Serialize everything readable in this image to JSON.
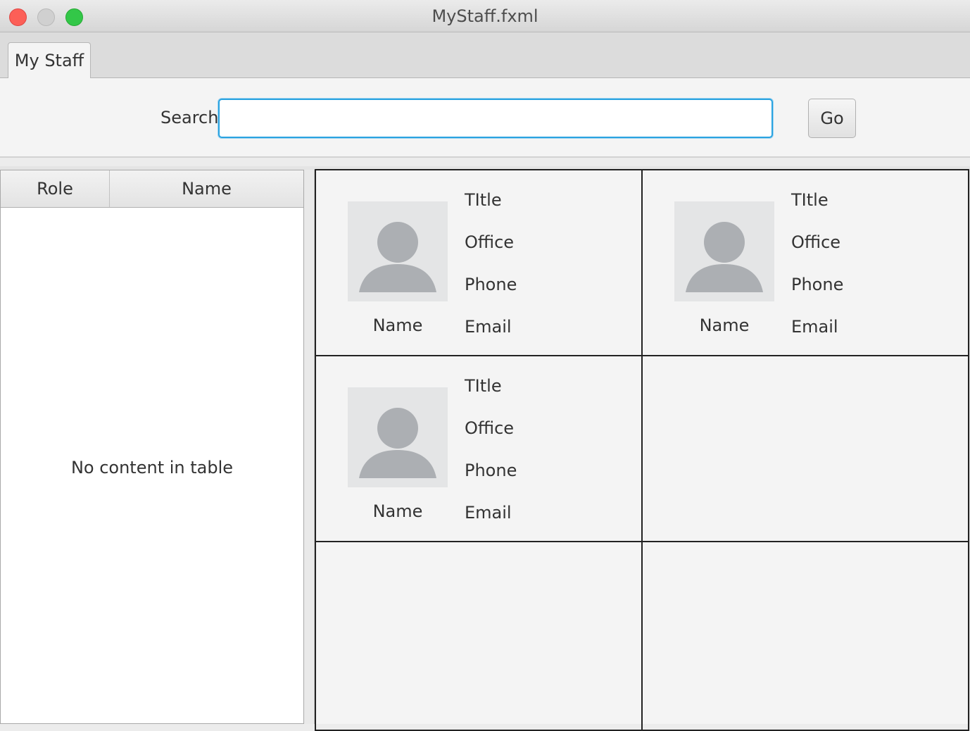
{
  "window": {
    "title": "MyStaff.fxml"
  },
  "tabs": [
    {
      "label": "My Staff"
    }
  ],
  "search": {
    "label": "Search",
    "value": "",
    "placeholder": "",
    "go_label": "Go"
  },
  "table": {
    "columns": [
      {
        "label": "Role"
      },
      {
        "label": "Name"
      }
    ],
    "empty_message": "No content in table"
  },
  "cards": [
    {
      "name": "Name",
      "title": "TItle",
      "office": "Office",
      "phone": "Phone",
      "email": "Email"
    },
    {
      "name": "Name",
      "title": "TItle",
      "office": "Office",
      "phone": "Phone",
      "email": "Email"
    },
    {
      "name": "Name",
      "title": "TItle",
      "office": "Office",
      "phone": "Phone",
      "email": "Email"
    }
  ],
  "colors": {
    "focus": "#2aa3e0",
    "close": "#fc5f57",
    "zoom": "#33c748",
    "avatar_bg": "#e4e5e6",
    "avatar_fg": "#acafb3"
  },
  "icons": {
    "avatar": "person-placeholder-icon"
  }
}
